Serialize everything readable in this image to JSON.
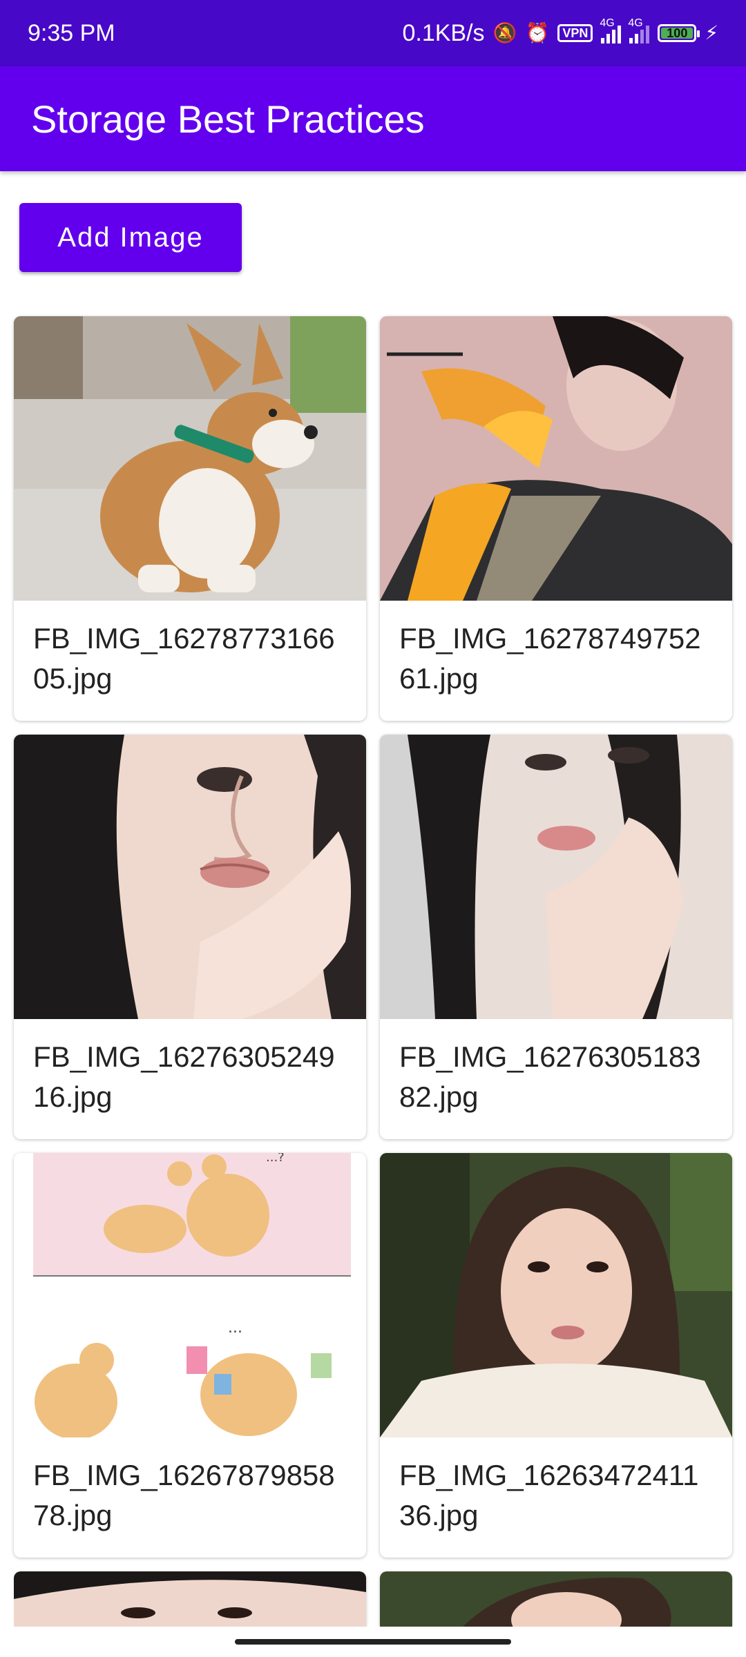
{
  "status_bar": {
    "time": "9:35 PM",
    "net_speed": "0.1KB/s",
    "vpn": "VPN",
    "net1": "4G",
    "net2": "4G",
    "battery": "100",
    "icons": [
      "mute-icon",
      "alarm-icon",
      "vpn-icon",
      "signal-icon",
      "signal-icon",
      "battery-icon",
      "charging-icon"
    ]
  },
  "app_bar": {
    "title": "Storage Best Practices"
  },
  "add_button": {
    "label": "Add Image"
  },
  "images": [
    {
      "name": "FB_IMG_1627877316605.jpg"
    },
    {
      "name": "FB_IMG_1627874975261.jpg"
    },
    {
      "name": "FB_IMG_1627630524916.jpg"
    },
    {
      "name": "FB_IMG_1627630518382.jpg"
    },
    {
      "name": "FB_IMG_1626787985878.jpg"
    },
    {
      "name": "FB_IMG_1626347241136.jpg"
    }
  ],
  "colors": {
    "status_bar": "#4808c8",
    "primary": "#6200ee"
  }
}
